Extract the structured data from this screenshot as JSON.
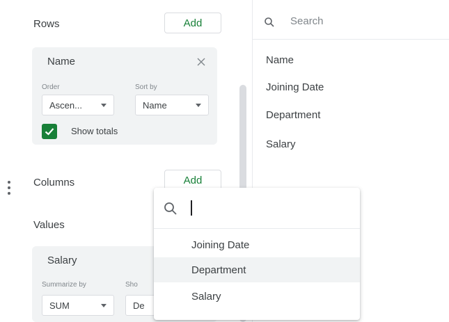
{
  "rows": {
    "label": "Rows",
    "add_label": "Add",
    "card": {
      "title": "Name",
      "order_caption": "Order",
      "order_value": "Ascen...",
      "sortby_caption": "Sort by",
      "sortby_value": "Name",
      "show_totals_label": "Show totals",
      "show_totals_checked": true
    }
  },
  "columns": {
    "label": "Columns",
    "add_label": "Add"
  },
  "values": {
    "label": "Values",
    "card": {
      "title": "Salary",
      "summarize_caption": "Summarize by",
      "summarize_value": "SUM",
      "show_caption": "Sho",
      "show_value": "De"
    }
  },
  "field_list": {
    "search_placeholder": "Search",
    "items": [
      "Name",
      "Joining Date",
      "Department",
      "Salary"
    ]
  },
  "popup": {
    "search_value": "",
    "items": [
      "Joining Date",
      "Department",
      "Salary"
    ],
    "highlighted_index": 1
  },
  "colors": {
    "accent_green": "#188038",
    "card_bg": "#f1f3f4",
    "highlight_bg": "#f1f3f4"
  }
}
